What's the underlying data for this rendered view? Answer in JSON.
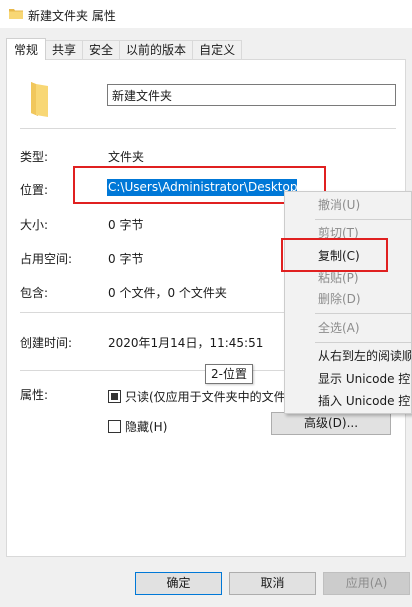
{
  "window": {
    "title": "新建文件夹 属性"
  },
  "tabs": [
    {
      "label": "常规",
      "active": true
    },
    {
      "label": "共享"
    },
    {
      "label": "安全"
    },
    {
      "label": "以前的版本"
    },
    {
      "label": "自定义"
    }
  ],
  "general": {
    "folder_name": "新建文件夹",
    "type_label": "类型:",
    "type_value": "文件夹",
    "location_label": "位置:",
    "location_value": "C:\\Users\\Administrator\\Desktop",
    "size_label": "大小:",
    "size_value": "0 字节",
    "size_on_disk_label": "占用空间:",
    "size_on_disk_value": "0 字节",
    "contains_label": "包含:",
    "contains_value": "0 个文件，0 个文件夹",
    "created_label": "创建时间:",
    "created_value": "2020年1月14日，11:45:51",
    "attributes_label": "属性:",
    "readonly_label": "只读(仅应用于文件夹中的文件",
    "hidden_label": "隐藏(H)",
    "advanced_button": "高级(D)..."
  },
  "tooltip": {
    "text": "2-位置"
  },
  "context_menu": {
    "items": [
      {
        "label": "撤消(U)",
        "disabled": true
      },
      {
        "label": "剪切(T)",
        "disabled": true
      },
      {
        "label": "复制(C)",
        "disabled": false
      },
      {
        "label": "粘贴(P)",
        "disabled": true
      },
      {
        "label": "删除(D)",
        "disabled": true
      },
      {
        "label": "全选(A)",
        "disabled": true
      },
      {
        "label": "从右到左的阅读顺",
        "disabled": false
      },
      {
        "label": "显示 Unicode 控",
        "disabled": false
      },
      {
        "label": "插入 Unicode 控",
        "disabled": false
      }
    ]
  },
  "footer": {
    "ok_label": "确定",
    "cancel_label": "取消",
    "apply_label": "应用(A)"
  },
  "colors": {
    "selection": "#0078d7",
    "highlight_box": "#e02020",
    "folder": "#f8d775"
  }
}
